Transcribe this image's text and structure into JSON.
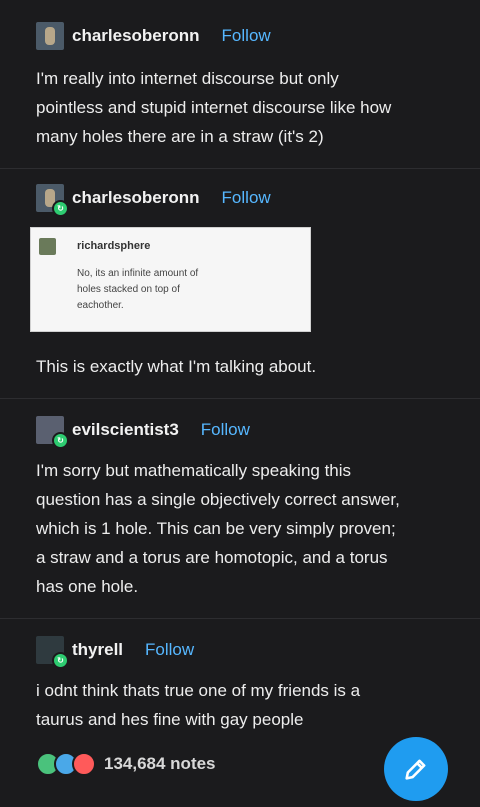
{
  "posts": [
    {
      "username": "charlesoberonn",
      "follow_label": "Follow",
      "lines": [
        "I'm really into internet discourse but only",
        "pointless and stupid internet discourse like how",
        "many holes there are in a straw (it's 2)"
      ]
    },
    {
      "username": "charlesoberonn",
      "follow_label": "Follow",
      "quote": {
        "username": "richardsphere",
        "lines": [
          "No, its an infinite amount of",
          "holes stacked on top of",
          "eachother."
        ]
      },
      "lines": [
        "This is exactly what I'm talking about."
      ]
    },
    {
      "username": "evilscientist3",
      "follow_label": "Follow",
      "lines": [
        "I'm sorry but mathematically speaking this",
        "question has a single objectively correct answer,",
        "which is 1 hole. This can be very simply proven;",
        "a straw and a torus are homotopic, and a torus",
        "has one hole."
      ]
    },
    {
      "username": "thyrell",
      "follow_label": "Follow",
      "lines": [
        "i odnt think thats true one of my friends is a",
        "taurus and hes fine with gay people"
      ]
    }
  ],
  "footer": {
    "notes": "134,684 notes",
    "note_icons": [
      "reblog-icon",
      "reply-icon",
      "like-icon"
    ],
    "colors": {
      "reblog": "#4ac27c",
      "reply": "#4aa8e8",
      "like": "#ff5a5a",
      "fab": "#1f9cf0",
      "follow": "#56b7ff"
    }
  }
}
